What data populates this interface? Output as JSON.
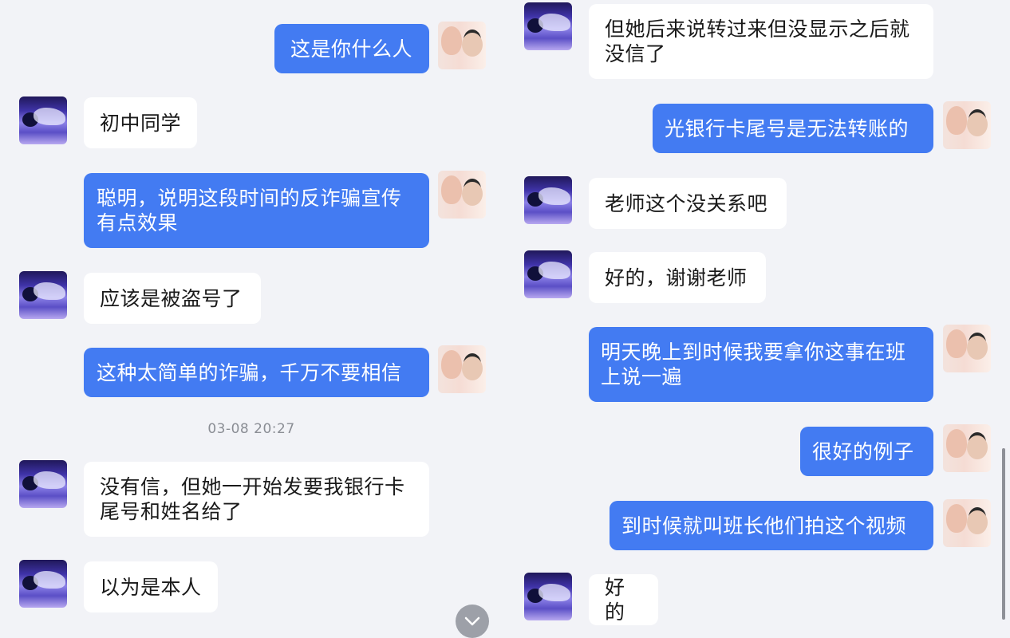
{
  "timestamp": "03-08 20:27",
  "left_column": [
    {
      "from": "me",
      "text": "这是你什么人"
    },
    {
      "from": "friend",
      "text": "初中同学"
    },
    {
      "from": "me",
      "lines": [
        "聪明，说明这段时间的反诈骗宣传",
        "有点效果"
      ]
    },
    {
      "from": "friend",
      "text": "应该是被盗号了"
    },
    {
      "from": "me",
      "text": "这种太简单的诈骗，千万不要相信"
    },
    {
      "from": "friend",
      "lines": [
        "没有信，但她一开始发要我银行卡",
        "尾号和姓名给了"
      ]
    },
    {
      "from": "friend",
      "text": "以为是本人"
    }
  ],
  "right_column": [
    {
      "from": "friend",
      "lines": [
        "但她后来说转过来但没显示之后就",
        "没信了"
      ]
    },
    {
      "from": "me",
      "text": "光银行卡尾号是无法转账的"
    },
    {
      "from": "friend",
      "text": "老师这个没关系吧"
    },
    {
      "from": "friend",
      "text": "好的，谢谢老师"
    },
    {
      "from": "me",
      "lines": [
        "明天晚上到时候我要拿你这事在班",
        "上说一遍"
      ]
    },
    {
      "from": "me",
      "text": "很好的例子"
    },
    {
      "from": "me",
      "text": "到时候就叫班长他们拍这个视频"
    },
    {
      "from": "friend",
      "text": "好的"
    }
  ],
  "icons": {
    "scroll_down": "chevron-down-icon"
  },
  "colors": {
    "sent_bubble": "#437bf2",
    "received_bubble": "#ffffff",
    "background": "#f2f3f7"
  }
}
